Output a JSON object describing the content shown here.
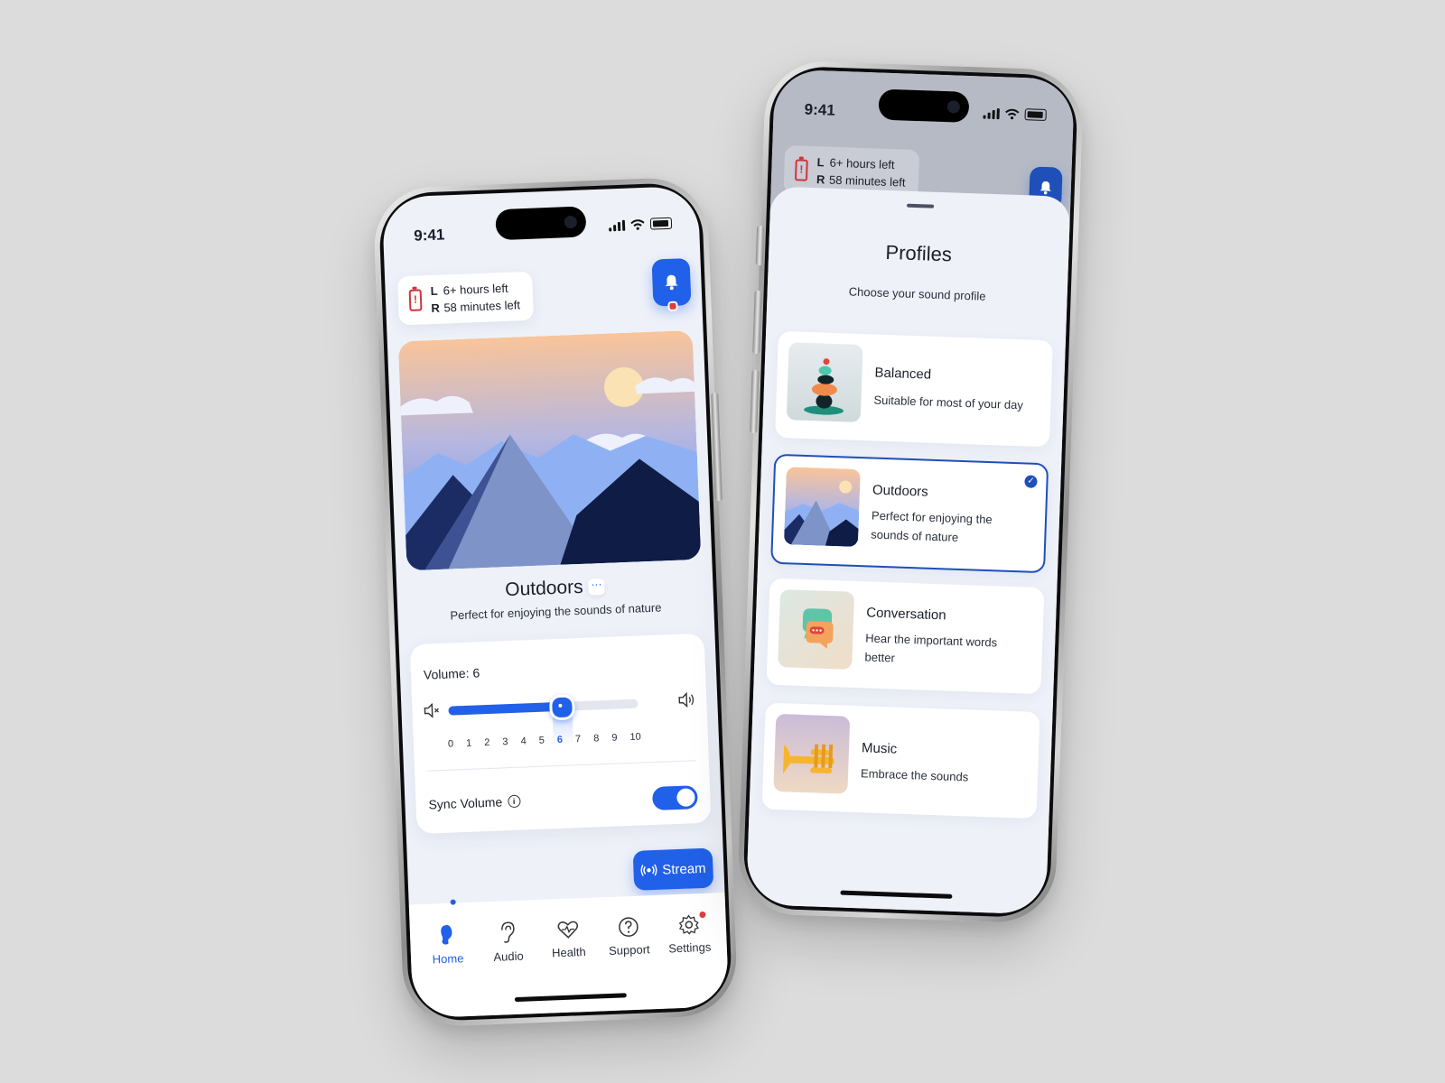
{
  "status_bar": {
    "time": "9:41"
  },
  "battery": {
    "left_label": "L",
    "left_value": "6+ hours left",
    "right_label": "R",
    "right_value": "58 minutes left"
  },
  "home": {
    "profile_name": "Outdoors",
    "profile_more": "···",
    "profile_description": "Perfect for enjoying the sounds of nature",
    "volume": {
      "label": "Volume: 6",
      "value": 6,
      "min": 0,
      "max": 10,
      "ticks": [
        "0",
        "1",
        "2",
        "3",
        "4",
        "5",
        "6",
        "7",
        "8",
        "9",
        "10"
      ]
    },
    "sync_volume": {
      "label": "Sync Volume",
      "info": "i",
      "enabled": true
    },
    "stream_label": "Stream"
  },
  "tabbar": {
    "tabs": [
      {
        "label": "Home",
        "icon": "hearing-aid-icon",
        "active": true
      },
      {
        "label": "Audio",
        "icon": "ear-icon",
        "active": false
      },
      {
        "label": "Health",
        "icon": "heart-pulse-icon",
        "active": false
      },
      {
        "label": "Support",
        "icon": "help-circle-icon",
        "active": false
      },
      {
        "label": "Settings",
        "icon": "gear-icon",
        "active": false,
        "badge": true
      }
    ]
  },
  "profiles_sheet": {
    "title": "Profiles",
    "subtitle": "Choose your sound profile",
    "items": [
      {
        "name": "Balanced",
        "description": "Suitable for most of your day",
        "selected": false
      },
      {
        "name": "Outdoors",
        "description": "Perfect for enjoying the sounds of nature",
        "selected": true
      },
      {
        "name": "Conversation",
        "description": "Hear the important words better",
        "selected": false
      },
      {
        "name": "Music",
        "description": "Embrace the sounds",
        "selected": false
      }
    ]
  },
  "colors": {
    "accent": "#2160e8",
    "alert": "#d0343a",
    "selected_border": "#1f4fb8"
  }
}
